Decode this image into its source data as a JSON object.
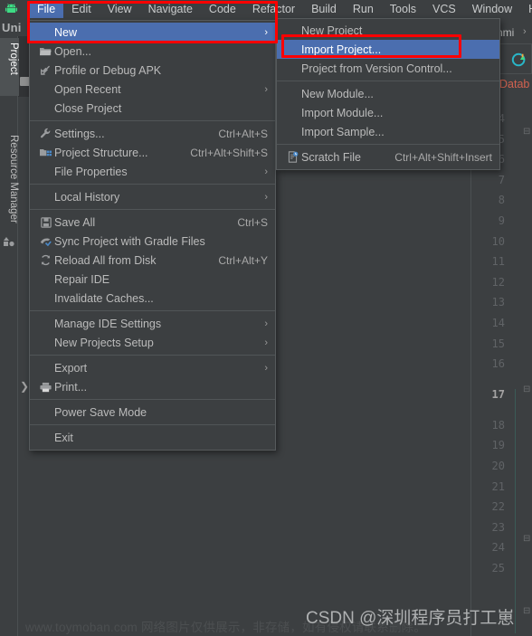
{
  "window": {
    "app_logo": "android-studio-logo",
    "project_tab_label": "Uni"
  },
  "menubar": {
    "items": [
      {
        "label": "File",
        "mnemonic": "F",
        "active": true
      },
      {
        "label": "Edit",
        "mnemonic": "E",
        "active": false
      },
      {
        "label": "View",
        "mnemonic": "V",
        "active": false
      },
      {
        "label": "Navigate",
        "mnemonic": "N",
        "active": false
      },
      {
        "label": "Code",
        "mnemonic": "C",
        "active": false
      },
      {
        "label": "Refactor",
        "mnemonic": "R",
        "active": false
      },
      {
        "label": "Build",
        "mnemonic": "B",
        "active": false
      },
      {
        "label": "Run",
        "mnemonic": "u",
        "active": false
      },
      {
        "label": "Tools",
        "mnemonic": "T",
        "active": false
      },
      {
        "label": "VCS",
        "mnemonic": "S",
        "active": false
      },
      {
        "label": "Window",
        "mnemonic": "W",
        "active": false
      },
      {
        "label": "Help",
        "mnemonic": "H",
        "active": false
      }
    ]
  },
  "file_menu": {
    "items": [
      {
        "label": "New",
        "icon": "",
        "shortcut": "",
        "arrow": "›",
        "selected": true,
        "sep_after": false
      },
      {
        "label": "Open...",
        "icon": "folder-open-icon",
        "shortcut": "",
        "arrow": "",
        "selected": false,
        "sep_after": false
      },
      {
        "label": "Profile or Debug APK",
        "icon": "profile-debug-apk-icon",
        "shortcut": "",
        "arrow": "",
        "selected": false,
        "sep_after": false
      },
      {
        "label": "Open Recent",
        "icon": "",
        "shortcut": "",
        "arrow": "›",
        "selected": false,
        "sep_after": false
      },
      {
        "label": "Close Project",
        "icon": "",
        "shortcut": "",
        "arrow": "",
        "selected": false,
        "sep_after": true
      },
      {
        "label": "Settings...",
        "icon": "wrench-icon",
        "shortcut": "Ctrl+Alt+S",
        "arrow": "",
        "selected": false,
        "sep_after": false
      },
      {
        "label": "Project Structure...",
        "icon": "project-structure-icon",
        "shortcut": "Ctrl+Alt+Shift+S",
        "arrow": "",
        "selected": false,
        "sep_after": false
      },
      {
        "label": "File Properties",
        "icon": "",
        "shortcut": "",
        "arrow": "›",
        "selected": false,
        "sep_after": true
      },
      {
        "label": "Local History",
        "icon": "",
        "shortcut": "",
        "arrow": "›",
        "selected": false,
        "sep_after": true
      },
      {
        "label": "Save All",
        "icon": "save-icon",
        "shortcut": "Ctrl+S",
        "arrow": "",
        "selected": false,
        "sep_after": false
      },
      {
        "label": "Sync Project with Gradle Files",
        "icon": "gradle-sync-icon",
        "shortcut": "",
        "arrow": "",
        "selected": false,
        "sep_after": false
      },
      {
        "label": "Reload All from Disk",
        "icon": "reload-icon",
        "shortcut": "Ctrl+Alt+Y",
        "arrow": "",
        "selected": false,
        "sep_after": false
      },
      {
        "label": "Repair IDE",
        "icon": "",
        "shortcut": "",
        "arrow": "",
        "selected": false,
        "sep_after": false
      },
      {
        "label": "Invalidate Caches...",
        "icon": "",
        "shortcut": "",
        "arrow": "",
        "selected": false,
        "sep_after": true
      },
      {
        "label": "Manage IDE Settings",
        "icon": "",
        "shortcut": "",
        "arrow": "›",
        "selected": false,
        "sep_after": false
      },
      {
        "label": "New Projects Setup",
        "icon": "",
        "shortcut": "",
        "arrow": "›",
        "selected": false,
        "sep_after": true
      },
      {
        "label": "Export",
        "icon": "",
        "shortcut": "",
        "arrow": "›",
        "selected": false,
        "sep_after": false
      },
      {
        "label": "Print...",
        "icon": "printer-icon",
        "shortcut": "",
        "arrow": "",
        "selected": false,
        "sep_after": true
      },
      {
        "label": "Power Save Mode",
        "icon": "",
        "shortcut": "",
        "arrow": "",
        "selected": false,
        "sep_after": true
      },
      {
        "label": "Exit",
        "icon": "",
        "shortcut": "",
        "arrow": "",
        "selected": false,
        "sep_after": false
      }
    ]
  },
  "new_submenu": {
    "items": [
      {
        "label": "New Project",
        "icon": "",
        "shortcut": "",
        "selected": false,
        "sep_after": false
      },
      {
        "label": "Import Project...",
        "icon": "",
        "shortcut": "",
        "selected": true,
        "sep_after": false
      },
      {
        "label": "Project from Version Control...",
        "icon": "",
        "shortcut": "",
        "selected": false,
        "sep_after": true
      },
      {
        "label": "New Module...",
        "icon": "",
        "shortcut": "",
        "selected": false,
        "sep_after": false
      },
      {
        "label": "Import Module...",
        "icon": "",
        "shortcut": "",
        "selected": false,
        "sep_after": false
      },
      {
        "label": "Import Sample...",
        "icon": "",
        "shortcut": "",
        "selected": false,
        "sep_after": true
      },
      {
        "label": "Scratch File",
        "icon": "scratch-file-icon",
        "shortcut": "Ctrl+Alt+Shift+Insert",
        "selected": false,
        "sep_after": false
      }
    ]
  },
  "tool_windows": {
    "project_tab": "Project",
    "resource_manager_tab": "Resource Manager"
  },
  "right_panel": {
    "run_config_fragment": "nmi",
    "chevron": "›",
    "database_label": "Datab",
    "circle_icon": "database-refresh-icon"
  },
  "editor": {
    "line_numbers": [
      "4",
      "5",
      "6",
      "7",
      "8",
      "9",
      "10",
      "11",
      "12",
      "13",
      "14",
      "15",
      "16",
      "17",
      "18",
      "19",
      "20",
      "21",
      "22",
      "23",
      "24",
      "25"
    ],
    "current_line": "17"
  },
  "annotations": {
    "boxes": [
      {
        "name": "file-new-highlight",
        "color": "#fe0000"
      },
      {
        "name": "import-project-highlight",
        "color": "#fe0000"
      }
    ]
  },
  "watermarks": {
    "left": "www.toymoban.com 网络图片仅供展示，非存储，如有侵权请联系删除。",
    "right": "CSDN @深圳程序员打工崽"
  }
}
